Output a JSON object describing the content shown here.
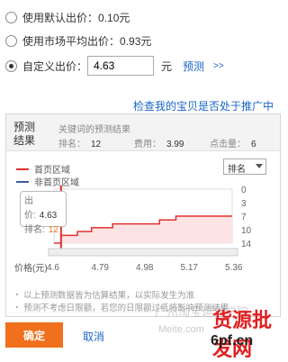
{
  "bids": {
    "default": {
      "label": "使用默认出价：",
      "value": "0.10元"
    },
    "market": {
      "label": "使用市场平均出价：",
      "value": "0.93元"
    },
    "custom": {
      "label": "自定义出价：",
      "input_value": "4.63",
      "unit": "元",
      "predict_link": "预测",
      "arrows": ">>"
    }
  },
  "check_link": "检查我的宝贝是否处于推广中",
  "predict": {
    "tag_line1": "预测",
    "tag_line2": "结果",
    "title": "关键词的预测结果",
    "rank_label": "排名：",
    "rank_value": "12",
    "fee_label": "费用：",
    "fee_value": "3.99",
    "clicks_label": "点击量：",
    "clicks_value": "6"
  },
  "legend": {
    "first_page": "首页区域",
    "non_first_page": "非首页区域"
  },
  "select": {
    "value": "排名"
  },
  "tooltip": {
    "bid_label": "出价:",
    "bid_value": "4.63",
    "rank_label": "排名:",
    "rank_value": "12"
  },
  "x_axis_label": "价格(元)",
  "notes": [
    "・ 以上预测数据皆为估算结果，以实际发生为准",
    "・ 预测不考虑日限额，若您的日限额过低将影响预测结果"
  ],
  "buttons": {
    "confirm": "确定",
    "cancel": "取消"
  },
  "watermark": {
    "line1": "广州淘宝运营学院",
    "brand": "货源批发网",
    "site": "6pf.cn",
    "domain": "Meite.com"
  },
  "colors": {
    "accent": "#f0701d",
    "link": "#1a66c9",
    "first_page": "#e03030",
    "non_first_page": "#3a5a9a"
  },
  "chart_data": {
    "type": "line",
    "x": [
      4.6,
      4.63,
      4.7,
      4.76,
      4.85,
      4.9,
      4.98,
      5.05,
      5.12,
      5.22,
      5.36
    ],
    "series": [
      {
        "values": [
          14,
          12,
          11,
          10,
          9,
          9,
          9,
          8,
          7,
          7,
          7
        ]
      }
    ],
    "xticks": [
      "4.6",
      "4.79",
      "4.98",
      "5.17",
      "5.36"
    ],
    "yticks": [
      "0",
      "3",
      "7",
      "10",
      "14"
    ],
    "xlabel": "价格(元)",
    "ylim": [
      14,
      0
    ],
    "marker_x": 4.63
  }
}
